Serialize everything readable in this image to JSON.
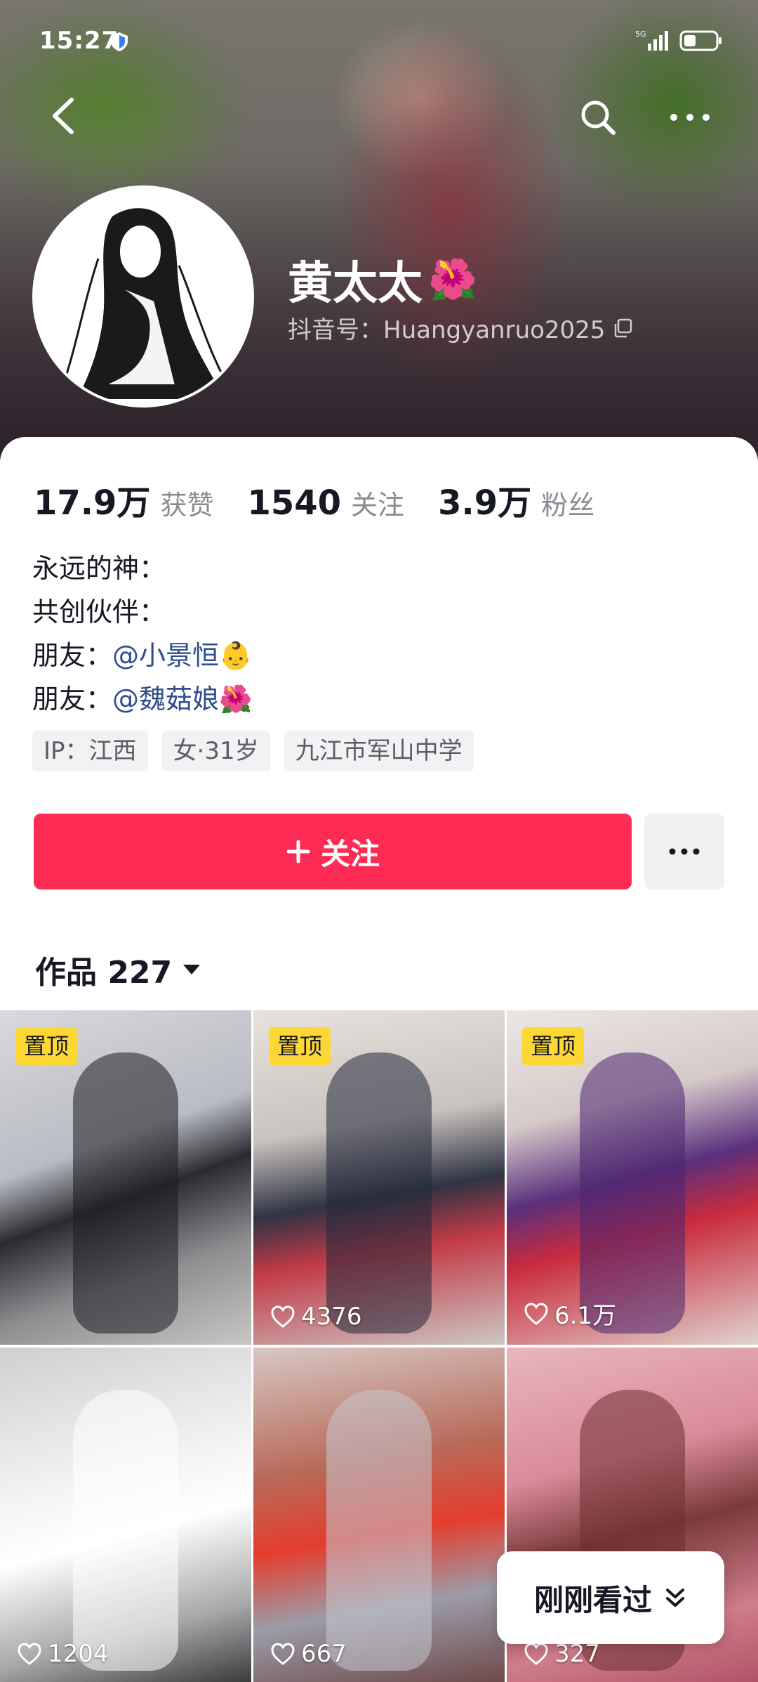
{
  "status_bar": {
    "time": "15:27",
    "network": "5G"
  },
  "profile": {
    "name": "黄太太",
    "name_emoji": "🌺",
    "douyin_id": "抖音号：Huangyanruo2025"
  },
  "stats": [
    {
      "value": "17.9万",
      "label": "获赞"
    },
    {
      "value": "1540",
      "label": "关注"
    },
    {
      "value": "3.9万",
      "label": "粉丝"
    }
  ],
  "bio": {
    "line1": "永远的神：",
    "line2": "共创伙伴：",
    "line3_prefix": "朋友：",
    "line3_mention": "@小景恒",
    "line3_emoji": "👶",
    "line4_prefix": "朋友：",
    "line4_mention": "@魏菇娘",
    "line4_emoji": "🌺"
  },
  "tags": [
    "IP：江西",
    "女·31岁",
    "九江市军山中学"
  ],
  "actions": {
    "follow_label": "关注",
    "more_label": "···"
  },
  "works": {
    "label": "作品 227"
  },
  "videos": [
    {
      "pinned": "置顶",
      "likes": ""
    },
    {
      "pinned": "置顶",
      "likes": "4376"
    },
    {
      "pinned": "置顶",
      "likes": "6.1万"
    },
    {
      "pinned": "",
      "likes": "1204"
    },
    {
      "pinned": "",
      "likes": "667"
    },
    {
      "pinned": "",
      "likes": "327"
    }
  ],
  "recent": {
    "label": "刚刚看过"
  },
  "colors": {
    "accent": "#fe2c55",
    "mention": "#2e4e8c",
    "pin_badge": "#fdd835"
  }
}
